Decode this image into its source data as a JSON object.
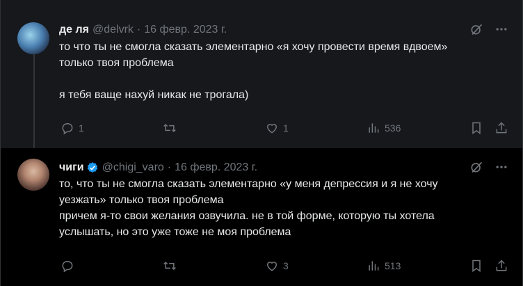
{
  "tweets": [
    {
      "name": "де ля",
      "handle": "@delvrk",
      "separator": "·",
      "date": "16 февр. 2023 г.",
      "verified": false,
      "text": [
        "то что ты не смогла сказать элементарно «я хочу провести время вдвоем»",
        "только твоя проблема",
        "",
        "я тебя ваще нахуй никак не трогала)"
      ],
      "stats": {
        "replies": "1",
        "retweets": "",
        "likes": "1",
        "views": "536"
      }
    },
    {
      "name": "чиги",
      "handle": "@chigi_varo",
      "separator": "·",
      "date": "16 февр. 2023 г.",
      "verified": true,
      "text": [
        "то, что ты не смогла сказать элементарно «у меня депрессия и я не хочу",
        "уезжать» только твоя проблема",
        "причем я-то свои желания озвучила. не в той форме, которую ты хотела",
        "услышать, но это уже тоже не моя проблема"
      ],
      "stats": {
        "replies": "",
        "retweets": "",
        "likes": "3",
        "views": "513"
      }
    }
  ],
  "colors": {
    "background": "#000000",
    "highlight_background": "#16181c",
    "text": "#e7e9ea",
    "secondary": "#71767b",
    "verified": "#1d9bf0"
  },
  "icons": [
    "grok-icon",
    "more-icon",
    "reply-icon",
    "retweet-icon",
    "like-icon",
    "views-icon",
    "bookmark-icon",
    "share-icon",
    "verified-icon"
  ]
}
